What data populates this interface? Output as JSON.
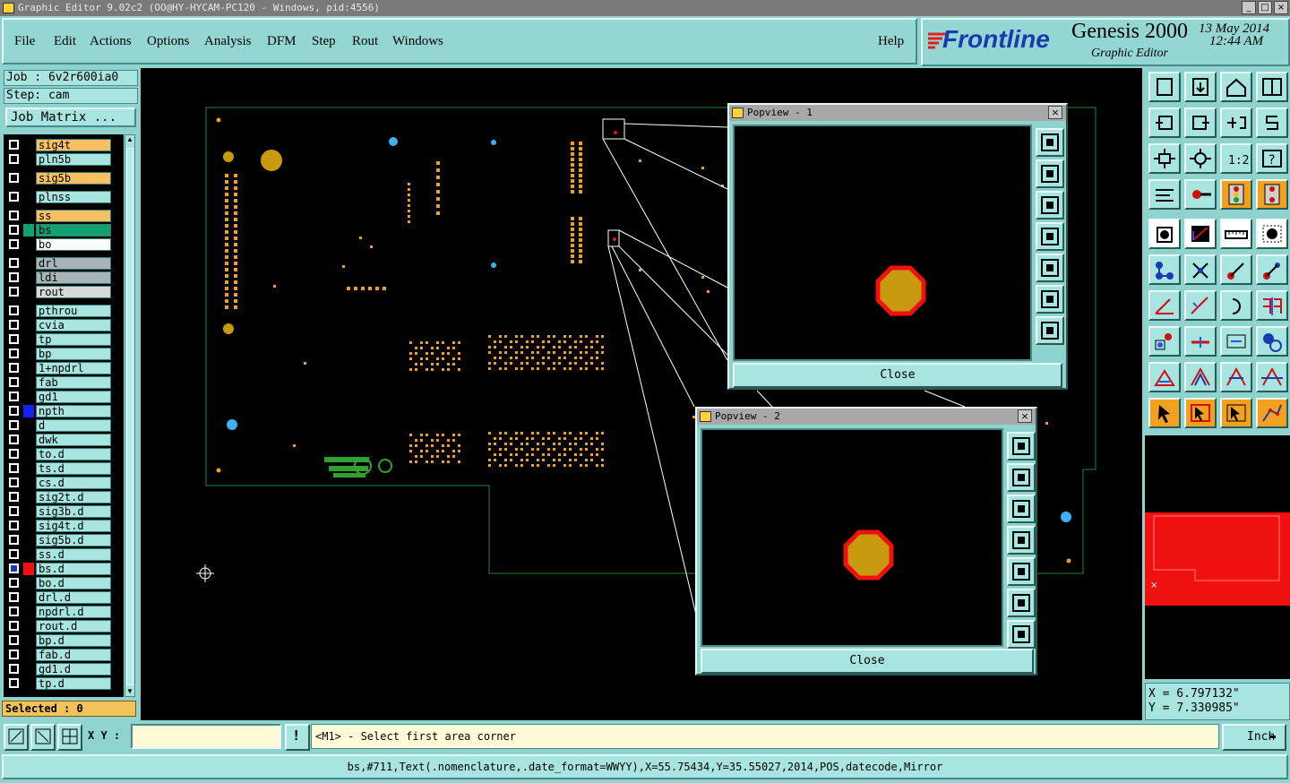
{
  "window": {
    "title": "Graphic Editor 9.02c2 (OO@HY-HYCAM-PC120 - Windows, pid:4556)"
  },
  "menu": {
    "items": [
      "File",
      "Edit",
      "Actions",
      "Options",
      "Analysis",
      "DFM",
      "Step",
      "Rout",
      "Windows"
    ],
    "help": "Help"
  },
  "brand": {
    "logo": "Frontline",
    "product": "Genesis 2000",
    "subtitle": "Graphic Editor",
    "date": "13 May 2014",
    "time": "12:44 AM"
  },
  "job": {
    "job_label": "Job : 6v2r600ia0",
    "step_label": "Step: cam",
    "job_matrix_button": "Job Matrix ..."
  },
  "layers": [
    {
      "name": "sig4t",
      "color": "#f8c060",
      "sw": "#000000",
      "gap": false
    },
    {
      "name": "pln5b",
      "color": "#a8e4e0",
      "sw": "#000000",
      "gap": false
    },
    {
      "name": "sig5b",
      "color": "#f8c060",
      "sw": "#000000",
      "gap": true
    },
    {
      "name": "plnss",
      "color": "#a8e4e0",
      "sw": "#000000",
      "gap": true
    },
    {
      "name": "ss",
      "color": "#f8c060",
      "sw": "#000000",
      "gap": true
    },
    {
      "name": "bs",
      "color": "#12a070",
      "sw": "#12a070",
      "gap": false
    },
    {
      "name": "bo",
      "color": "#ffffff",
      "sw": "#000000",
      "gap": false
    },
    {
      "name": "drl",
      "color": "#a8b4b8",
      "sw": "#000000",
      "gap": true
    },
    {
      "name": "ldi",
      "color": "#a8b4b8",
      "sw": "#000000",
      "gap": false
    },
    {
      "name": "rout",
      "color": "#d8d8d8",
      "sw": "#000000",
      "gap": false
    },
    {
      "name": "pthrou",
      "color": "#a8e4e0",
      "sw": "#000000",
      "gap": true
    },
    {
      "name": "cvia",
      "color": "#a8e4e0",
      "sw": "#000000",
      "gap": false
    },
    {
      "name": "tp",
      "color": "#a8e4e0",
      "sw": "#000000",
      "gap": false
    },
    {
      "name": "bp",
      "color": "#a8e4e0",
      "sw": "#000000",
      "gap": false
    },
    {
      "name": "1+npdrl",
      "color": "#a8e4e0",
      "sw": "#000000",
      "gap": false
    },
    {
      "name": "fab",
      "color": "#a8e4e0",
      "sw": "#000000",
      "gap": false
    },
    {
      "name": "gd1",
      "color": "#a8e4e0",
      "sw": "#000000",
      "gap": false
    },
    {
      "name": "npth",
      "color": "#a8e4e0",
      "sw": "#1820f0",
      "gap": false
    },
    {
      "name": "d",
      "color": "#a8e4e0",
      "sw": "#000000",
      "gap": false
    },
    {
      "name": "dwk",
      "color": "#a8e4e0",
      "sw": "#000000",
      "gap": false
    },
    {
      "name": "to.d",
      "color": "#a8e4e0",
      "sw": "#000000",
      "gap": false
    },
    {
      "name": "ts.d",
      "color": "#a8e4e0",
      "sw": "#000000",
      "gap": false
    },
    {
      "name": "cs.d",
      "color": "#a8e4e0",
      "sw": "#000000",
      "gap": false
    },
    {
      "name": "sig2t.d",
      "color": "#a8e4e0",
      "sw": "#000000",
      "gap": false
    },
    {
      "name": "sig3b.d",
      "color": "#a8e4e0",
      "sw": "#000000",
      "gap": false
    },
    {
      "name": "sig4t.d",
      "color": "#a8e4e0",
      "sw": "#000000",
      "gap": false
    },
    {
      "name": "sig5b.d",
      "color": "#a8e4e0",
      "sw": "#000000",
      "gap": false
    },
    {
      "name": "ss.d",
      "color": "#a8e4e0",
      "sw": "#000000",
      "gap": false
    },
    {
      "name": "bs.d",
      "color": "#a8e4e0",
      "sw": "#f01010",
      "gap": false,
      "active": true
    },
    {
      "name": "bo.d",
      "color": "#a8e4e0",
      "sw": "#000000",
      "gap": false
    },
    {
      "name": "drl.d",
      "color": "#a8e4e0",
      "sw": "#000000",
      "gap": false
    },
    {
      "name": "npdrl.d",
      "color": "#a8e4e0",
      "sw": "#000000",
      "gap": false
    },
    {
      "name": "rout.d",
      "color": "#a8e4e0",
      "sw": "#000000",
      "gap": false
    },
    {
      "name": "bp.d",
      "color": "#a8e4e0",
      "sw": "#000000",
      "gap": false
    },
    {
      "name": "fab.d",
      "color": "#a8e4e0",
      "sw": "#000000",
      "gap": false
    },
    {
      "name": "gd1.d",
      "color": "#a8e4e0",
      "sw": "#000000",
      "gap": false
    },
    {
      "name": "tp.d",
      "color": "#a8e4e0",
      "sw": "#000000",
      "gap": false
    }
  ],
  "selected_label": "Selected : 0",
  "popview1": {
    "title": "Popview - 1",
    "close": "Close"
  },
  "popview2": {
    "title": "Popview - 2",
    "close": "Close"
  },
  "coords": {
    "x": "X = 6.797132\"",
    "y": "Y = 7.330985\""
  },
  "bottom": {
    "xy_label": "X Y :",
    "xy_value": "",
    "prompt": "<M1> - Select first area corner",
    "unit": "Inch",
    "status": "bs,#711,Text(.nomenclature,.date_format=WWYY),X=55.75434,Y=35.55027,2014,POS,datecode,Mirror"
  },
  "colors": {
    "pad": "#c89a10",
    "pad_outline": "#f01010",
    "board_outline": "#1a8a40",
    "via": "#40b0f0",
    "smd": "#f0a020"
  },
  "icons": {
    "tools": [
      "open-step-icon",
      "save-icon",
      "home-icon",
      "split-icon",
      "pan-left-icon",
      "pan-right-icon",
      "zoom-back-icon",
      "redraw-icon",
      "fit-icon",
      "center-icon",
      "scale-icon",
      "help-icon",
      "measure-icon",
      "snap-icon",
      "layer-toggle-icon",
      "layer-compare-icon",
      "select-icon",
      "profile-icon",
      "ruler-icon",
      "dot-icon"
    ]
  }
}
